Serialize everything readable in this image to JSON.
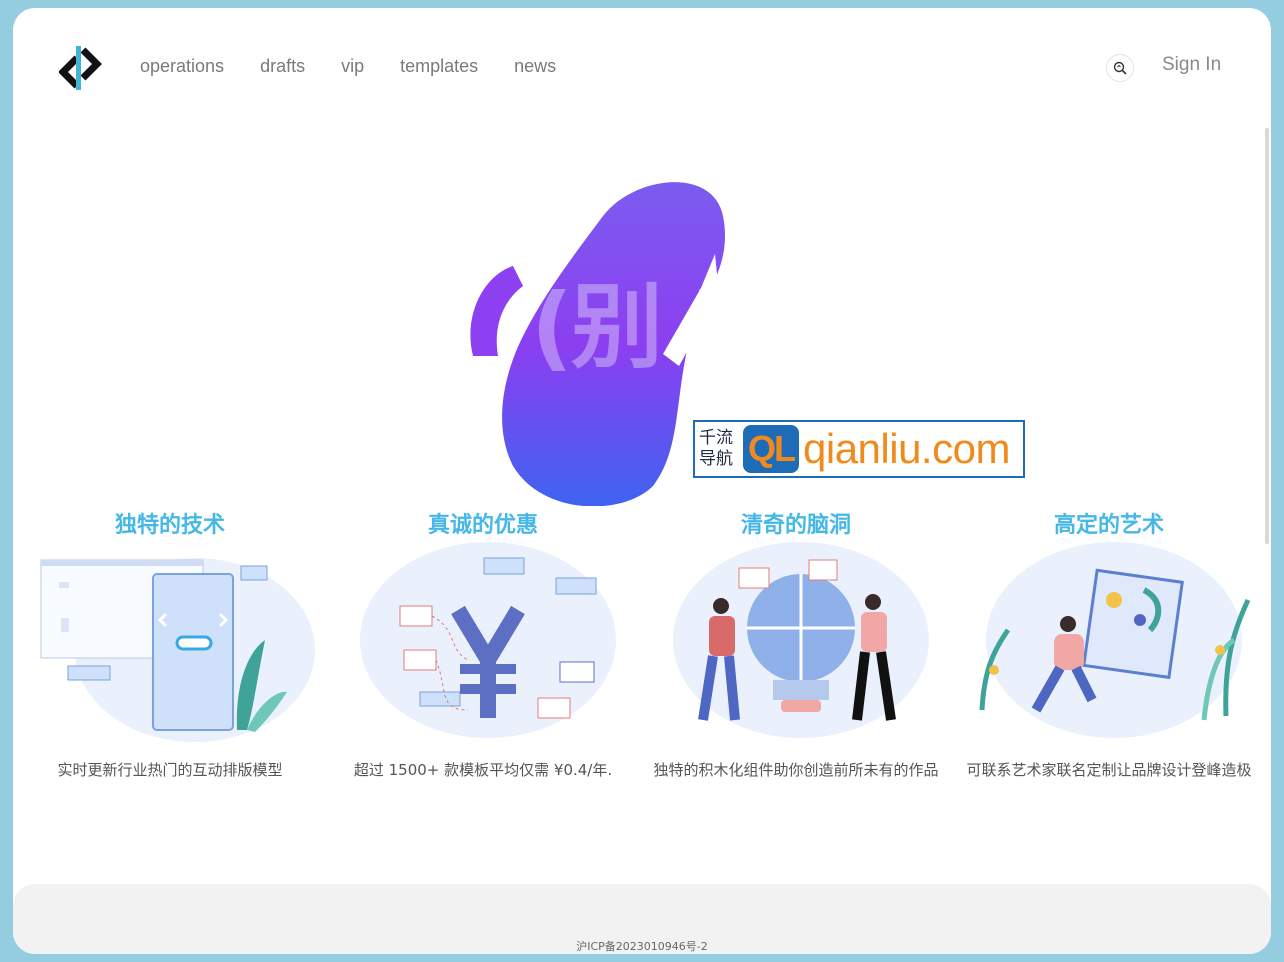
{
  "nav": {
    "items": [
      "operations",
      "drafts",
      "vip",
      "templates",
      "news"
    ],
    "signin": "Sign In"
  },
  "hero": {
    "text": "(别 )"
  },
  "watermark": {
    "cn_line1": "千流",
    "cn_line2": "导航",
    "ql": "QL",
    "domain": "qianliu.com"
  },
  "features": [
    {
      "title": "独特的技术",
      "desc": "实时更新行业热门的互动排版模型"
    },
    {
      "title": "真诚的优惠",
      "desc": "超过 1500+ 款模板平均仅需 ¥0.4/年."
    },
    {
      "title": "清奇的脑洞",
      "desc": "独特的积木化组件助你创造前所未有的作品"
    },
    {
      "title": "高定的艺术",
      "desc": "可联系艺术家联名定制让品牌设计登峰造极"
    }
  ],
  "footer": {
    "icp": "沪ICP备2023010946号-2"
  },
  "colors": {
    "accent": "#45b8e8",
    "hero_gradient_top": "#7b5cf0",
    "hero_gradient_bottom": "#3f63f0",
    "watermark_blue": "#1e6bb8",
    "watermark_orange": "#f08a1c"
  },
  "icons": {
    "logo": "bracket-logo-icon",
    "search": "search-icon"
  }
}
